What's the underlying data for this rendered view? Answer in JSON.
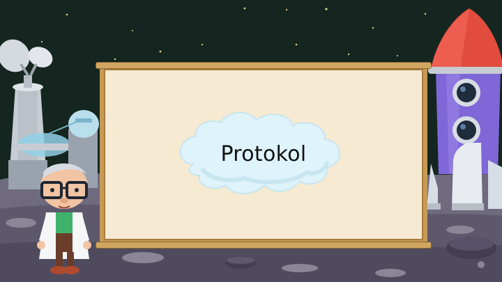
{
  "slide": {
    "title": "Protokol"
  },
  "colors": {
    "sky": "#14261f",
    "ground": "#6f6a7e",
    "board": "#f6ead2",
    "board_frame": "#c79a55",
    "rocket_body": "#7f67d8",
    "rocket_nose": "#e24c3e",
    "cloud": "#dff3fa"
  },
  "icons": [
    "satellite-dish-icon",
    "observatory-tower-icon",
    "rocket-icon",
    "scientist-character",
    "cloud-icon",
    "crater-icon"
  ]
}
